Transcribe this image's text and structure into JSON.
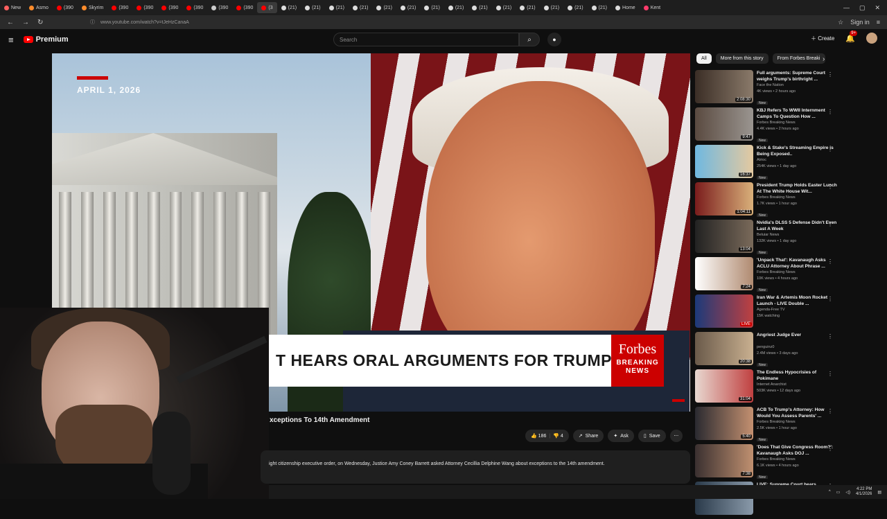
{
  "browser": {
    "tabs": [
      {
        "label": "New",
        "color": "#ff5f5f",
        "active": false
      },
      {
        "label": "Asmo",
        "color": "#ff8c2b",
        "active": false
      },
      {
        "label": "(390",
        "color": "#ff0000",
        "active": false
      },
      {
        "label": "Skyrim",
        "color": "#ff8c2b",
        "active": false
      },
      {
        "label": "(390",
        "color": "#ff0000",
        "active": false
      },
      {
        "label": "(390",
        "color": "#ff0000",
        "active": false
      },
      {
        "label": "(390",
        "color": "#ff0000",
        "active": false
      },
      {
        "label": "(390",
        "color": "#ff0000",
        "active": false
      },
      {
        "label": "(390",
        "color": "#cccccc",
        "active": false
      },
      {
        "label": "(390",
        "color": "#ff0000",
        "active": false
      },
      {
        "label": "(3",
        "color": "#ff0000",
        "active": true
      },
      {
        "label": "(21)",
        "color": "#dddddd",
        "active": false
      },
      {
        "label": "(21)",
        "color": "#dddddd",
        "active": false
      },
      {
        "label": "(21)",
        "color": "#dddddd",
        "active": false
      },
      {
        "label": "(21)",
        "color": "#dddddd",
        "active": false
      },
      {
        "label": "(21)",
        "color": "#dddddd",
        "active": false
      },
      {
        "label": "(21)",
        "color": "#dddddd",
        "active": false
      },
      {
        "label": "(21)",
        "color": "#dddddd",
        "active": false
      },
      {
        "label": "(21)",
        "color": "#dddddd",
        "active": false
      },
      {
        "label": "(21)",
        "color": "#dddddd",
        "active": false
      },
      {
        "label": "(21)",
        "color": "#dddddd",
        "active": false
      },
      {
        "label": "(21)",
        "color": "#dddddd",
        "active": false
      },
      {
        "label": "(21)",
        "color": "#dddddd",
        "active": false
      },
      {
        "label": "(21)",
        "color": "#dddddd",
        "active": false
      },
      {
        "label": "(21)",
        "color": "#dddddd",
        "active": false
      },
      {
        "label": "Home",
        "color": "#dddddd",
        "active": false
      },
      {
        "label": "Kent",
        "color": "#ff3b6b",
        "active": false
      }
    ],
    "url": "www.youtube.com/watch?v=tJeHzCanaA",
    "sign_in": "Sign in"
  },
  "header": {
    "logo_text": "Premium",
    "search_placeholder": "Search",
    "create_label": "Create",
    "notification_count": "9+"
  },
  "video": {
    "date": "APRIL 1, 2026",
    "lower_third": "T HEARS ORAL ARGUMENTS FOR TRUMP",
    "forbes_name": "Forbes",
    "forbes_sub": "BREAKING NEWS",
    "title": "xceptions To 14th Amendment",
    "likes": "186",
    "dislikes": "4",
    "share": "Share",
    "ask": "Ask",
    "save": "Save",
    "description": "ight citizenship executive order, on Wednesday, Justice Amy Coney Barrett  asked Attorney Cecillia Delphine Wang about exceptions to the 14th amendment."
  },
  "chips": [
    "All",
    "More from this story",
    "From Forbes Breaki"
  ],
  "recommendations": [
    {
      "title": "Full arguments: Supreme Court weighs Trump's birthright ...",
      "channel": "Face the Nation",
      "meta": "4K views • 2 hours ago",
      "duration": "2:08:30",
      "new": "New",
      "colors": [
        "#3b2e26",
        "#8a7a6a"
      ]
    },
    {
      "title": "KBJ Refers To WWII Internment Camps To Question How ...",
      "channel": "Forbes Breaking News",
      "meta": "4.4K views • 2 hours ago",
      "duration": "9:47",
      "new": "New",
      "colors": [
        "#5a4a40",
        "#9a9590"
      ]
    },
    {
      "title": "Kick & Stake's Streaming Empire is Being Exposed..",
      "channel": "Atrioc",
      "meta": "254K views • 1 day ago",
      "duration": "16:37",
      "new": "New",
      "colors": [
        "#6fb8e0",
        "#e4c9a0"
      ]
    },
    {
      "title": "President Trump Holds Easter Lunch At The White House Wit...",
      "channel": "Forbes Breaking News",
      "meta": "1.7K views • 1 hour ago",
      "duration": "1:04:11",
      "new": "New",
      "colors": [
        "#7a1c1c",
        "#d9b07a"
      ]
    },
    {
      "title": "Nvidia's DLSS 5 Defense Didn't Even Last A Week",
      "channel": "Beluiar News",
      "meta": "132K views • 1 day ago",
      "duration": "13:04",
      "new": "New",
      "colors": [
        "#222222",
        "#7a6a5a"
      ]
    },
    {
      "title": "'Unpack That': Kavanaugh Asks ACLU Attorney About Phrase ...",
      "channel": "Forbes Breaking News",
      "meta": "10K views • 4 hours ago",
      "duration": "7:24",
      "new": "New",
      "colors": [
        "#ffffff",
        "#b08a70"
      ]
    },
    {
      "title": "Iran War & Artemis Moon Rocket Launch - LIVE Double ...",
      "channel": "Agenda-Free TV",
      "meta": "15K watching",
      "duration": "LIVE",
      "new": "",
      "colors": [
        "#1c3a7a",
        "#c04040"
      ]
    },
    {
      "title": "Angriest Judge Ever",
      "channel": "penguinz0",
      "meta": "2.4M views • 3 days ago",
      "duration": "20:38",
      "new": "New",
      "colors": [
        "#6a5a4a",
        "#c9b090"
      ]
    },
    {
      "title": "The Endless Hypocrisies of Pokimane",
      "channel": "Internet Anarchist",
      "meta": "503K views • 12 days ago",
      "duration": "31:04",
      "new": "",
      "colors": [
        "#e8d8d0",
        "#c04040"
      ]
    },
    {
      "title": "ACB To Trump's Attorney: How Would You Assess Parents' ...",
      "channel": "Forbes Breaking News",
      "meta": "2.5K views • 1 hour ago",
      "duration": "5:40",
      "new": "New",
      "colors": [
        "#2a2a30",
        "#c49070"
      ]
    },
    {
      "title": "'Does That Give Congress Room?': Kavanaugh Asks DOJ ...",
      "channel": "Forbes Breaking News",
      "meta": "6.1K views • 4 hours ago",
      "duration": "7:38",
      "new": "New",
      "colors": [
        "#3a3030",
        "#c09070"
      ]
    },
    {
      "title": "LIVE: Supreme Court hears",
      "channel": "",
      "meta": "",
      "duration": "",
      "new": "",
      "colors": [
        "#2a3a4a",
        "#8a9aaa"
      ]
    }
  ],
  "taskbar": {
    "time": "4:22 PM",
    "date": "4/1/2026"
  }
}
